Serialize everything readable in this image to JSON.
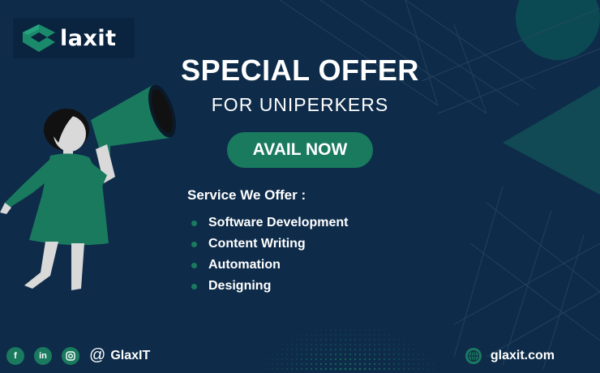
{
  "brand": {
    "name": "laxit"
  },
  "headline": "SPECIAL OFFER",
  "subheadline": "FOR UNIPERKERS",
  "cta_label": "AVAIL NOW",
  "services": {
    "title": "Service We Offer :",
    "items": [
      "Software Development",
      "Content Writing",
      "Automation",
      "Designing"
    ]
  },
  "footer": {
    "social_icons": [
      "facebook-icon",
      "linkedin-icon",
      "instagram-icon"
    ],
    "facebook_glyph": "f",
    "linkedin_glyph": "in",
    "handle": "GlaxIT",
    "website": "glaxit.com"
  },
  "colors": {
    "background": "#0e2c4a",
    "accent": "#1a7a5e",
    "text": "#ffffff"
  }
}
